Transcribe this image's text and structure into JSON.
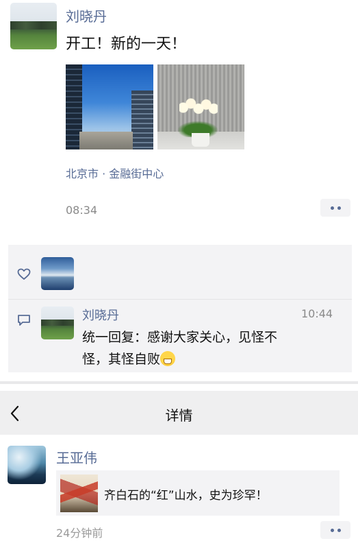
{
  "post1": {
    "author": "刘晓丹",
    "text": "开工！新的一天！",
    "location": "北京市 · 金融街中心",
    "time": "08:34"
  },
  "interactions": {
    "comment": {
      "author": "刘晓丹",
      "time": "10:44",
      "text_line1": "统一回复：感谢大家关心，见怪不",
      "text_line2": "怪，其怪自败"
    }
  },
  "detail_nav": {
    "title": "详情"
  },
  "post2": {
    "author": "王亚伟",
    "share_title": "齐白石的“红”山水，史为珍罕！",
    "time_ago": "24分钟前"
  },
  "icons": {
    "like": "heart-outline-icon",
    "comment": "comment-bubble-icon",
    "back": "chevron-left-icon",
    "more": "more-dots-icon"
  },
  "colors": {
    "link_blue": "#576b95",
    "panel_gray": "#f3f3f5"
  }
}
